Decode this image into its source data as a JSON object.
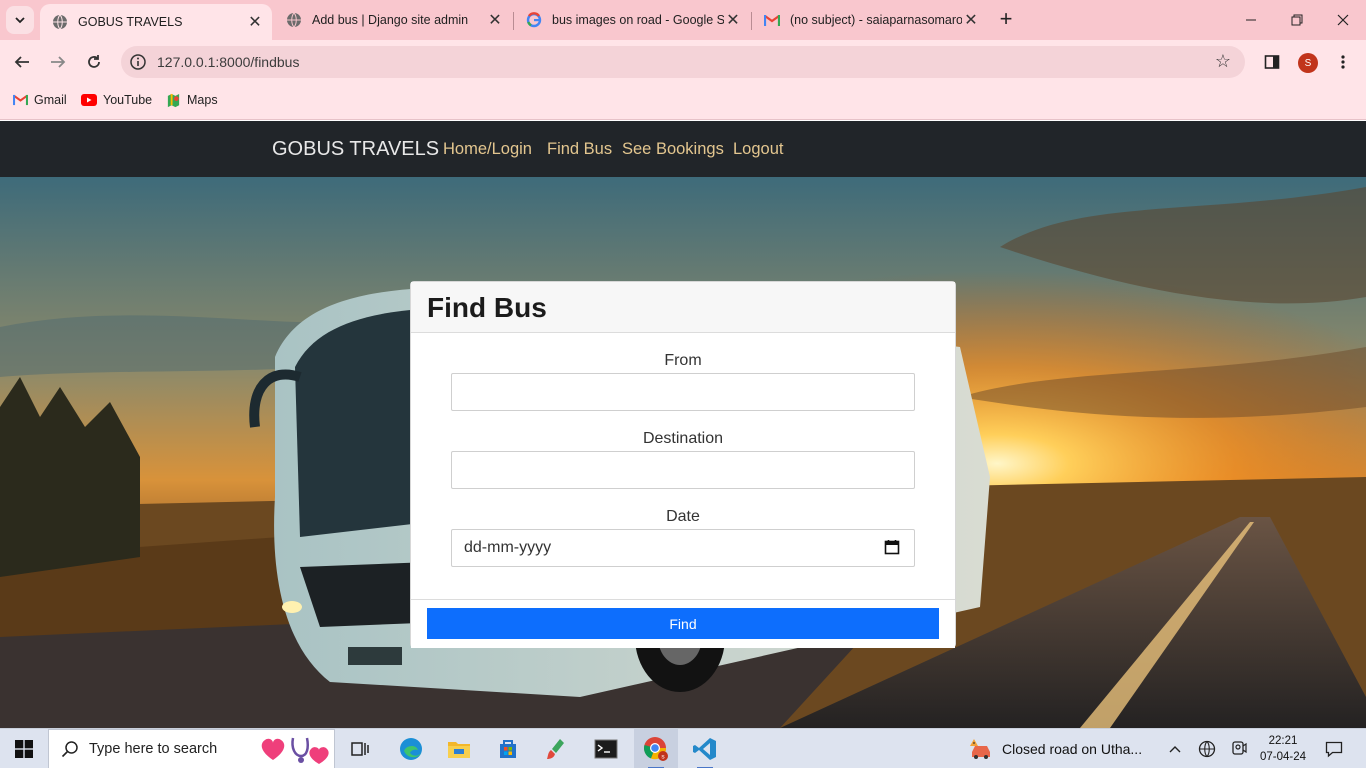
{
  "browser": {
    "tabs": [
      {
        "title": "GOBUS TRAVELS",
        "active": true
      },
      {
        "title": "Add bus | Django site admin",
        "active": false
      },
      {
        "title": "bus images on road - Google S",
        "active": false
      },
      {
        "title": "(no subject) - saiaparnasomaro",
        "active": false
      }
    ],
    "url": "127.0.0.1:8000/findbus",
    "profile_initial": "S",
    "bookmarks": [
      {
        "label": "Gmail",
        "icon": "gmail-icon"
      },
      {
        "label": "YouTube",
        "icon": "youtube-icon"
      },
      {
        "label": "Maps",
        "icon": "maps-icon"
      }
    ]
  },
  "navbar": {
    "brand": "GOBUS TRAVELS",
    "links": [
      "Home/Login",
      "Find Bus",
      "See Bookings",
      "Logout"
    ]
  },
  "form": {
    "title": "Find Bus",
    "from_label": "From",
    "destination_label": "Destination",
    "date_label": "Date",
    "date_placeholder": "dd-mm-yyyy",
    "submit_label": "Find"
  },
  "taskbar": {
    "search_placeholder": "Type here to search",
    "notification": "Closed road on Utha...",
    "time": "22:21",
    "date": "07-04-24"
  },
  "colors": {
    "tabstrip": "#f9c7ce",
    "navbar": "#212529",
    "navlink": "#e3c68f",
    "primary": "#0d6efd"
  }
}
